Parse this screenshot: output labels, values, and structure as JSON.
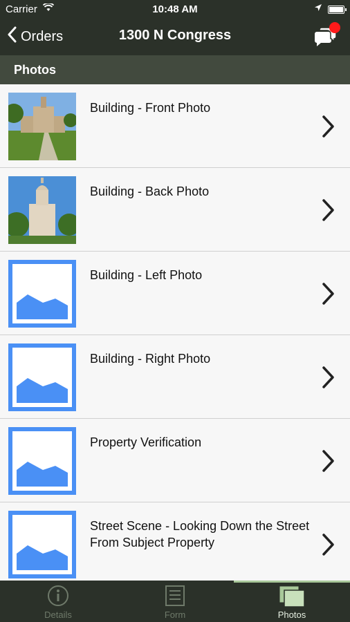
{
  "status_bar": {
    "carrier": "Carrier",
    "time": "10:48 AM"
  },
  "nav": {
    "back_label": "Orders",
    "title": "1300 N Congress"
  },
  "section": {
    "title": "Photos"
  },
  "items": [
    {
      "label": "Building - Front Photo",
      "thumb": "photo-front"
    },
    {
      "label": "Building - Back Photo",
      "thumb": "photo-back"
    },
    {
      "label": "Building - Left Photo",
      "thumb": "placeholder"
    },
    {
      "label": "Building - Right Photo",
      "thumb": "placeholder"
    },
    {
      "label": "Property Verification",
      "thumb": "placeholder"
    },
    {
      "label": "Street Scene - Looking Down the Street From Subject Property",
      "thumb": "placeholder"
    }
  ],
  "tabs": [
    {
      "label": "Details",
      "icon": "info-icon",
      "active": false
    },
    {
      "label": "Form",
      "icon": "form-icon",
      "active": false
    },
    {
      "label": "Photos",
      "icon": "photos-icon",
      "active": true
    }
  ],
  "colors": {
    "bar_bg": "#2b3129",
    "section_bg": "#424a3e",
    "placeholder_blue": "#4a90f5",
    "badge_red": "#ff1a1a"
  }
}
